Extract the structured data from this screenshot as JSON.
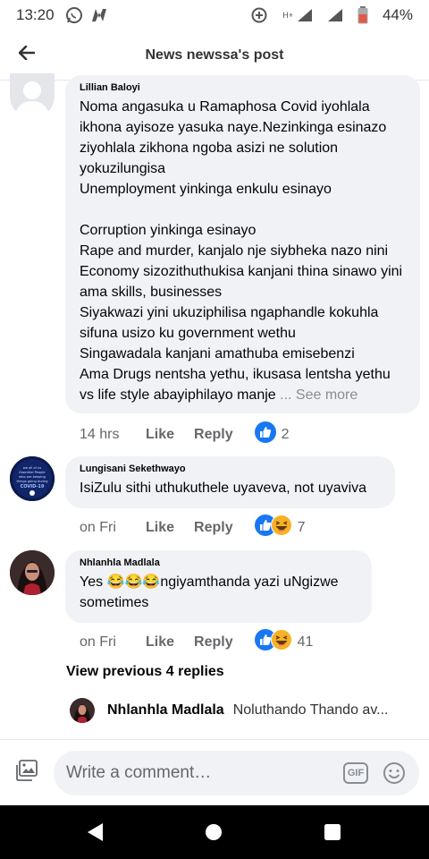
{
  "status_bar": {
    "time": "13:20",
    "network_label": "H+",
    "battery": "44%"
  },
  "header": {
    "title": "News newssa's post"
  },
  "comments": [
    {
      "author": "Lillian Baloyi",
      "text": "Noma angasuka u Ramaphosa Covid iyohlala ikhona ayisoze yasuka naye.Nezinkinga esinazo ziyohlala zikhona ngoba asizi ne solution yokuzilungisa\nUnemployment yinkinga enkulu esinayo\n\nCorruption yinkinga esinayo\nRape and murder, kanjalo nje siybheka nazo nini\nEconomy sizozithuthukisa kanjani thina sinawo yini ama skills, businesses\nSiyakwazi yini ukuziphilisa ngaphandle kokuhla sifuna usizo ku government wethu\nSingawadala kanjani amathuba emisebenzi\nAma Drugs nentsha yethu, ikusasa lentsha yethu vs life style abayiphilayo manje",
      "see_more": "... See more",
      "time": "14 hrs",
      "like": "Like",
      "reply": "Reply",
      "reaction_count": "2"
    },
    {
      "author": "Lungisani Sekethwayo",
      "avatar_text": "we all of us  Essential People  who are keeping  things going during  COVID-19",
      "text": "IsiZulu sithi uthukuthele uyaveva, not uyaviva",
      "time": "on Fri",
      "like": "Like",
      "reply": "Reply",
      "reaction_count": "7"
    },
    {
      "author": "Nhlanhla Madlala",
      "text_before": "Yes ",
      "emojis": "😂😂😂",
      "text_after": "ngiyamthanda yazi uNgizwe sometimes",
      "time": "on Fri",
      "like": "Like",
      "reply": "Reply",
      "reaction_count": "41"
    }
  ],
  "view_previous": "View previous 4 replies",
  "reply_preview": {
    "author": "Nhlanhla Madlala",
    "text": "Noluthando Thando av..."
  },
  "composer": {
    "placeholder": "Write a comment…",
    "gif_label": "GIF"
  },
  "colors": {
    "like_blue": "#1877f2",
    "haha_yellow": "#f7b125",
    "bubble_bg": "#f0f2f5"
  },
  "icons": [
    "back-arrow-icon",
    "photo-icon",
    "gif-icon",
    "emoji-icon",
    "like-reaction-icon",
    "haha-reaction-icon",
    "nav-back-icon",
    "nav-home-icon",
    "nav-recents-icon"
  ]
}
